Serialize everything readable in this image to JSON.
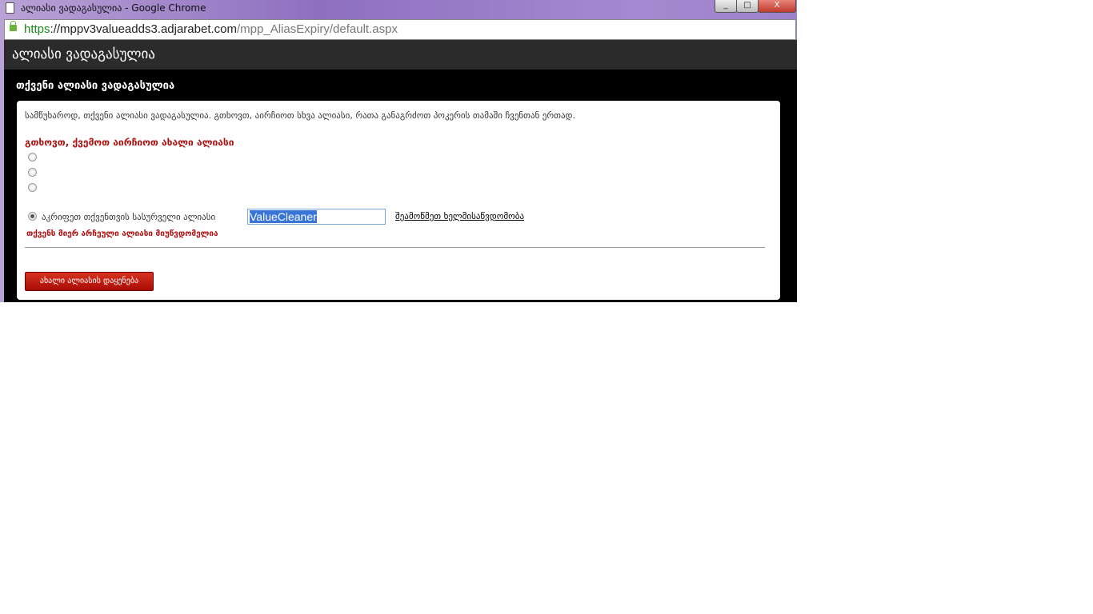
{
  "window": {
    "title": "ალიასი ვადაგასულია - Google Chrome",
    "controls": [
      "_",
      "□",
      "X"
    ]
  },
  "url": {
    "scheme": "https",
    "host": "://mppv3valueadds3.adjarabet.com",
    "path": "/mpp_AliasExpiry/default.aspx"
  },
  "page": {
    "header": "ალიასი ვადაგასულია",
    "subtitle": "თქვენი ალიასი ვადაგასულია",
    "message": "სამწუხაროდ, თქვენი ალიასი ვადაგასულია. გთხოვთ, აირჩიოთ სხვა ალიასი, რათა განაგრძოთ პოკერის თამაში ჩვენთან ერთად.",
    "choose_prompt": "გთხოვთ, ქვემოთ აირჩიოთ ახალი ალიასი",
    "custom_label": "აკრიფეთ თქვენთვის სასურველი ალიასი",
    "alias_value": "ValueCleaner",
    "check_link": "შეამოწმეთ ხელმისაწვდომობა",
    "error": "თქვენს მიერ არჩეული ალიასი მიუწვდომელია",
    "submit": "ახალი ალიასის დაყენება"
  }
}
